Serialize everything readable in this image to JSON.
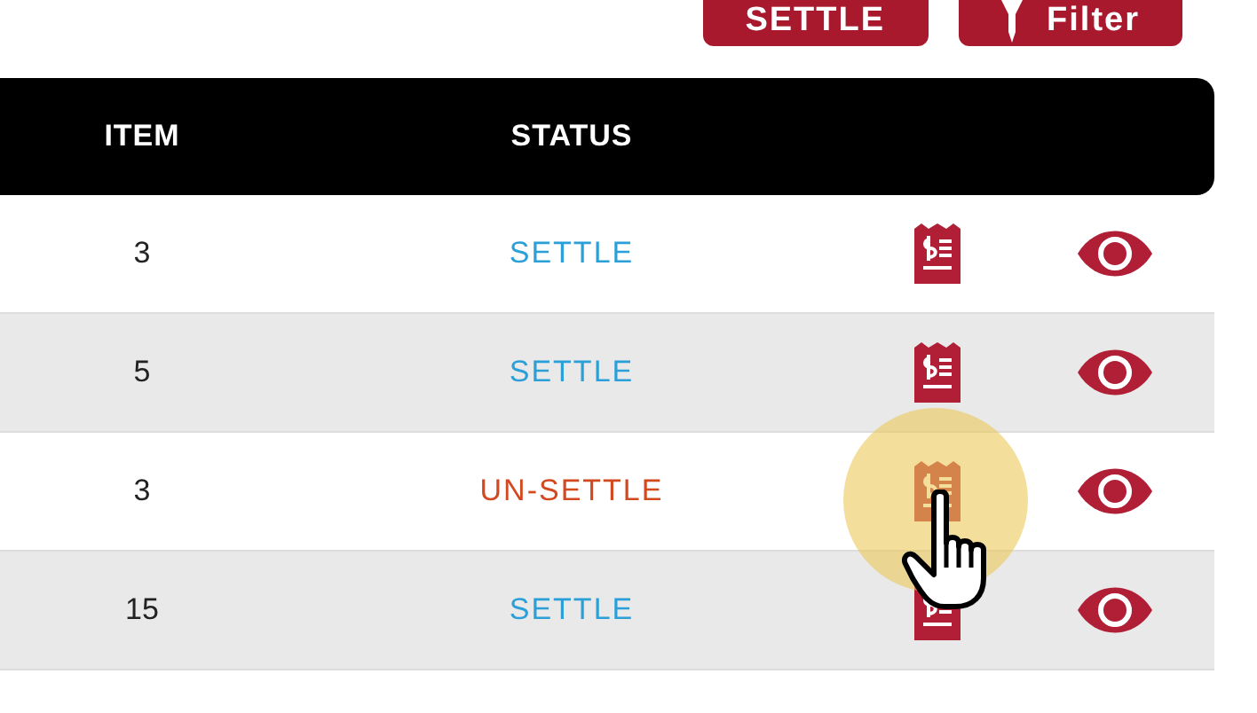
{
  "toolbar": {
    "buttons": [
      {
        "label": "SETTLE",
        "kind": "text"
      },
      {
        "label": "Filter",
        "kind": "filter"
      }
    ]
  },
  "table": {
    "columns": [
      "ITEM",
      "STATUS"
    ],
    "rows": [
      {
        "item": "3",
        "status": "SETTLE",
        "kind": "settle",
        "pointer": false
      },
      {
        "item": "5",
        "status": "SETTLE",
        "kind": "settle",
        "pointer": false
      },
      {
        "item": "3",
        "status": "UN-SETTLE",
        "kind": "unsettle",
        "pointer": true
      },
      {
        "item": "15",
        "status": "SETTLE",
        "kind": "settle",
        "pointer": false
      }
    ]
  }
}
